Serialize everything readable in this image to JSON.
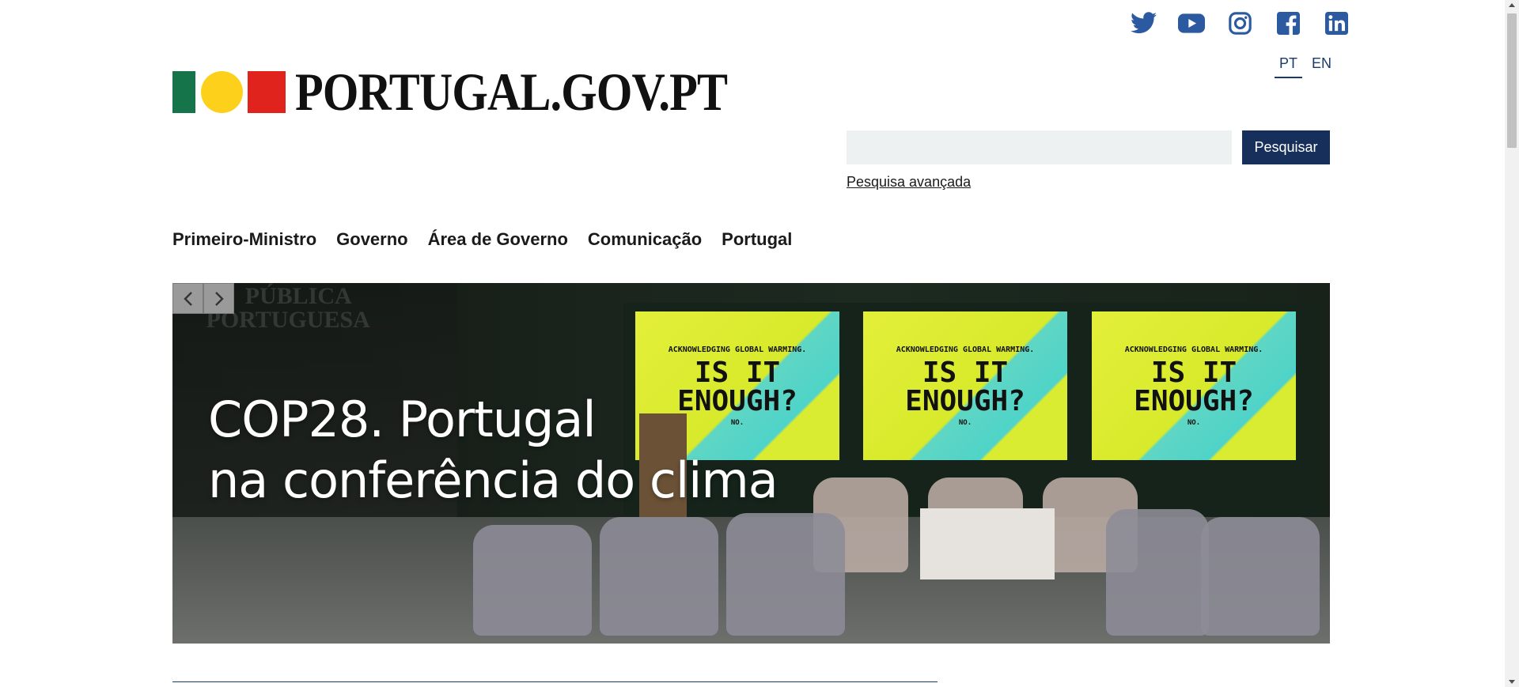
{
  "header": {
    "logo_text": "PORTUGAL.GOV.PT",
    "social": [
      {
        "icon": "twitter-icon"
      },
      {
        "icon": "youtube-icon"
      },
      {
        "icon": "instagram-icon"
      },
      {
        "icon": "facebook-icon"
      },
      {
        "icon": "linkedin-icon"
      }
    ],
    "languages": [
      {
        "label": "PT",
        "active": true
      },
      {
        "label": "EN",
        "active": false
      }
    ]
  },
  "search": {
    "value": "",
    "placeholder": "",
    "button_label": "Pesquisar",
    "advanced_label": "Pesquisa avançada"
  },
  "nav": {
    "items": [
      {
        "label": "Primeiro-Ministro"
      },
      {
        "label": "Governo"
      },
      {
        "label": "Área de Governo"
      },
      {
        "label": "Comunicação"
      },
      {
        "label": "Portugal"
      }
    ]
  },
  "hero": {
    "title_line1": "COP28. Portugal",
    "title_line2": "na conferência do clima",
    "screen_small": "ACKNOWLEDGING GLOBAL WARMING.",
    "screen_big": "IS IT ENOUGH?",
    "screen_tiny": "NO.",
    "panel_text": "REPÚBLICA PORTUGUESA",
    "prev_icon": "chevron-left-icon",
    "next_icon": "chevron-right-icon"
  },
  "colors": {
    "brand_blue": "#17305b",
    "flag_green": "#16744a",
    "flag_yellow": "#fdd11b",
    "flag_red": "#e1231e",
    "social_blue": "#2c5aa0"
  }
}
